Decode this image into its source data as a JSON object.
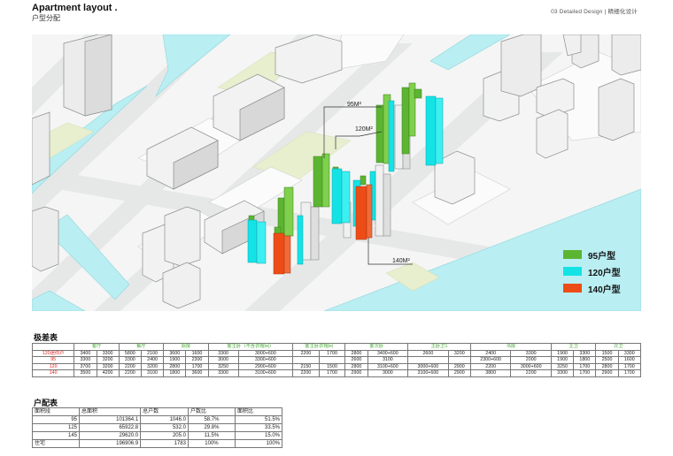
{
  "header": {
    "title": "Apartment layout .",
    "subtitle": "户型分配",
    "right_text": "03    Detailed Design  |  精细化设计"
  },
  "plan": {
    "callouts": {
      "a": "95M²",
      "b": "120M²",
      "c": "140M²"
    },
    "legend": [
      {
        "label": "95户型",
        "color": "#5cb531"
      },
      {
        "label": "120户型",
        "color": "#14e3e6"
      },
      {
        "label": "140户型",
        "color": "#ee4c16"
      }
    ],
    "colors": {
      "green": "#5cb531",
      "cyan": "#14e3e6",
      "orange": "#ee4c16",
      "water": "#b9eef2",
      "park": "#e8efcf"
    }
  },
  "height_table": {
    "title": "极差表",
    "headers": [
      "",
      "客厅",
      "餐厅",
      "厨房",
      "客主卧（不含衣帽间）",
      "客主卧衣帽间",
      "客次卧",
      "主卧卫1",
      "书房",
      "主卫",
      "次卫"
    ],
    "rows": [
      [
        "120迷你户",
        "3400",
        "3300",
        "5800",
        "2100",
        "3600",
        "1600",
        "3300",
        "3000+600",
        "2200",
        "1700",
        "2800",
        "3400+600",
        "2600",
        "3200",
        "2400",
        "3300",
        "1900",
        "3300",
        "1500",
        "3300"
      ],
      [
        "95",
        "3300",
        "3200",
        "3300",
        "2400",
        "1900",
        "2300",
        "3000",
        "3300+600",
        "",
        "",
        "2600",
        "3100",
        "",
        "",
        "2300+600",
        "2000",
        "1900",
        "1800",
        "2500",
        "1600"
      ],
      [
        "120",
        "3700",
        "3200",
        "2200",
        "3200",
        "2800",
        "1700",
        "3250",
        "2900+600",
        "2150",
        "1500",
        "2800",
        "3100+600",
        "3000+600",
        "2900",
        "2200",
        "3000+600",
        "3250",
        "1700",
        "2800",
        "1700"
      ],
      [
        "140",
        "3500",
        "4200",
        "2200",
        "3100",
        "1800",
        "3600",
        "3300",
        "3100+600",
        "2200",
        "1700",
        "2900",
        "3000",
        "3100+600",
        "2900",
        "3800",
        "2200",
        "3300",
        "1700",
        "2900",
        "1700"
      ]
    ]
  },
  "unit_table": {
    "title": "户配表",
    "headers": [
      "面积段",
      "总面积",
      "总户数",
      "户数比",
      "面积比"
    ],
    "rows": [
      [
        "95",
        "101364.1",
        "1046.0",
        "58.7%",
        "51.5%"
      ],
      [
        "125",
        "65922.8",
        "532.0",
        "29.8%",
        "33.5%"
      ],
      [
        "145",
        "29620.0",
        "205.0",
        "11.5%",
        "15.0%"
      ],
      [
        "住宅",
        "196906.9",
        "1783",
        "100%",
        "100%"
      ]
    ]
  }
}
